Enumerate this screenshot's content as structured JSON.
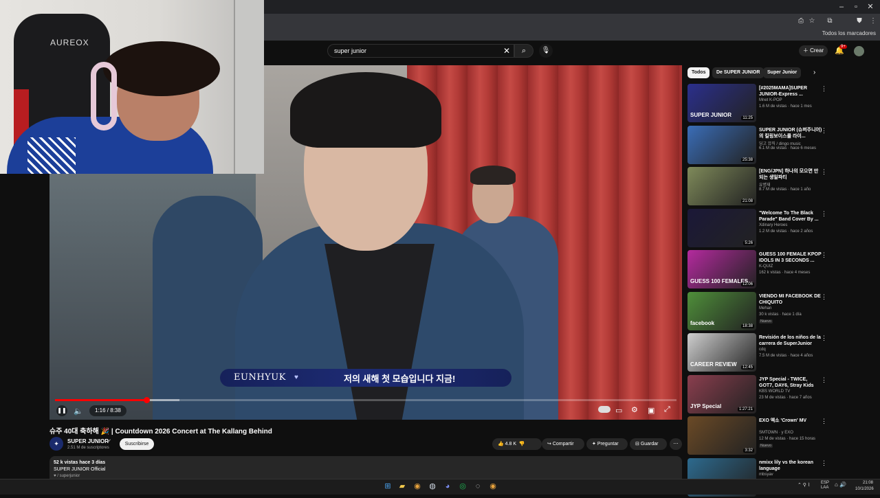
{
  "browser": {
    "bookmarks_folder": "Todos los marcadores",
    "window_controls": [
      "–",
      "▫",
      "✕"
    ]
  },
  "header": {
    "search_query": "super junior",
    "create_label": "Crear",
    "notif_count": "9+"
  },
  "player": {
    "subtitle_name": "EUNHYUK",
    "subtitle_text": "저의 새해 첫 모습입니다 지금!",
    "time": "1:16 / 8:38",
    "progress": 0.147,
    "buffered": 0.2
  },
  "webcam": {
    "chair_logo": "AUREOX"
  },
  "video": {
    "title": "슈주 40대 축하해 🎉 | Countdown 2026 Concert at The Kallang Behind",
    "channel": "SUPER JUNIOR",
    "subscribers": "2.51 M de suscriptores",
    "subscribe_label": "Suscribirse",
    "likes": "4.8 K",
    "share_label": "Compartir",
    "ask_label": "Preguntar",
    "save_label": "Guardar",
    "desc_views": "52 k vistas  hace 3 días",
    "desc_channel": "SUPER JUNIOR Official",
    "desc_link": "♥ / superjunior"
  },
  "sidebar": {
    "chips": [
      "Todos",
      "De SUPER JUNIOR",
      "Super Junior"
    ],
    "recommendations": [
      {
        "title": "[#2025MAMA]SUPER JUNIOR-Express ...",
        "channel": "Mnet K-POP",
        "meta": "1.6 M de vistas · hace 1 mes",
        "duration": "11:25",
        "label": "SUPER JUNIOR",
        "color": "#2b2f8c",
        "badge": ""
      },
      {
        "title": "SUPER JUNIOR (슈퍼주니어)의 킬링보이스를 라이...",
        "channel": "딩고 뮤직 / dingo music",
        "meta": "6.1 M de vistas · hace 6 meses",
        "duration": "25:38",
        "label": "",
        "color": "#3a6db7",
        "badge": ""
      },
      {
        "title": "[ENG/JPN] 하나의 모으면 만되는 생일파티",
        "channel": "유병재",
        "meta": "8.7 M de vistas · hace 1 año",
        "duration": "21:08",
        "label": "",
        "color": "#7f8a5a",
        "badge": ""
      },
      {
        "title": "\"Welcome To The Black Parade\" Band Cover By ...",
        "channel": "Xdinary Heroes",
        "meta": "1.2 M de vistas · hace 2 años",
        "duration": "5:26",
        "label": "",
        "color": "#1b1838",
        "badge": ""
      },
      {
        "title": "GUESS 100 FEMALE KPOP IDOLS IN 3 SECONDS ...",
        "channel": "K-QUIZ",
        "meta": "162 k vistas · hace 4 meses",
        "duration": "12:06",
        "label": "GUESS 100 FEMALES",
        "color": "#b42a9e",
        "badge": ""
      },
      {
        "title": "VIENDO MI FACEBOOK DE CHIQUITO",
        "channel": "Mehan",
        "meta": "30 k vistas · hace 1 día",
        "duration": "18:38",
        "label": "facebook",
        "color": "#4f8f3a",
        "badge": "Nuevo"
      },
      {
        "title": "Revisión de los niños de la carrera de SuperJunior",
        "channel": "cdq",
        "meta": "7.5 M de vistas · hace 4 años",
        "duration": "12:45",
        "label": "CAREER REVIEW",
        "color": "#cfcfcf",
        "badge": ""
      },
      {
        "title": "JYP Special - TWICE, GOT7, DAY6, Stray Kids",
        "channel": "KBS WORLD TV",
        "meta": "23 M de vistas · hace 7 años",
        "duration": "1:27:21",
        "label": "JYP Special",
        "color": "#8a3e4e",
        "badge": ""
      },
      {
        "title": "EXO 엑소 'Crown' MV",
        "channel": "SMTOWN · y EXO",
        "meta": "12 M de vistas · hace 15 horas",
        "duration": "3:32",
        "label": "",
        "color": "#6b4a26",
        "badge": "Nuevo"
      },
      {
        "title": "nmixx lily vs the korean language",
        "channel": "mbsyav",
        "meta": "",
        "duration": "",
        "label": "whats that?",
        "color": "#2d6a8e",
        "badge": ""
      }
    ]
  },
  "taskbar": {
    "lang": "ESP\nLAA",
    "time": "21:08",
    "date": "10/1/2026"
  },
  "colors": {
    "accent": "#ff0000",
    "background": "#0f0f0f",
    "chip": "#272727"
  }
}
